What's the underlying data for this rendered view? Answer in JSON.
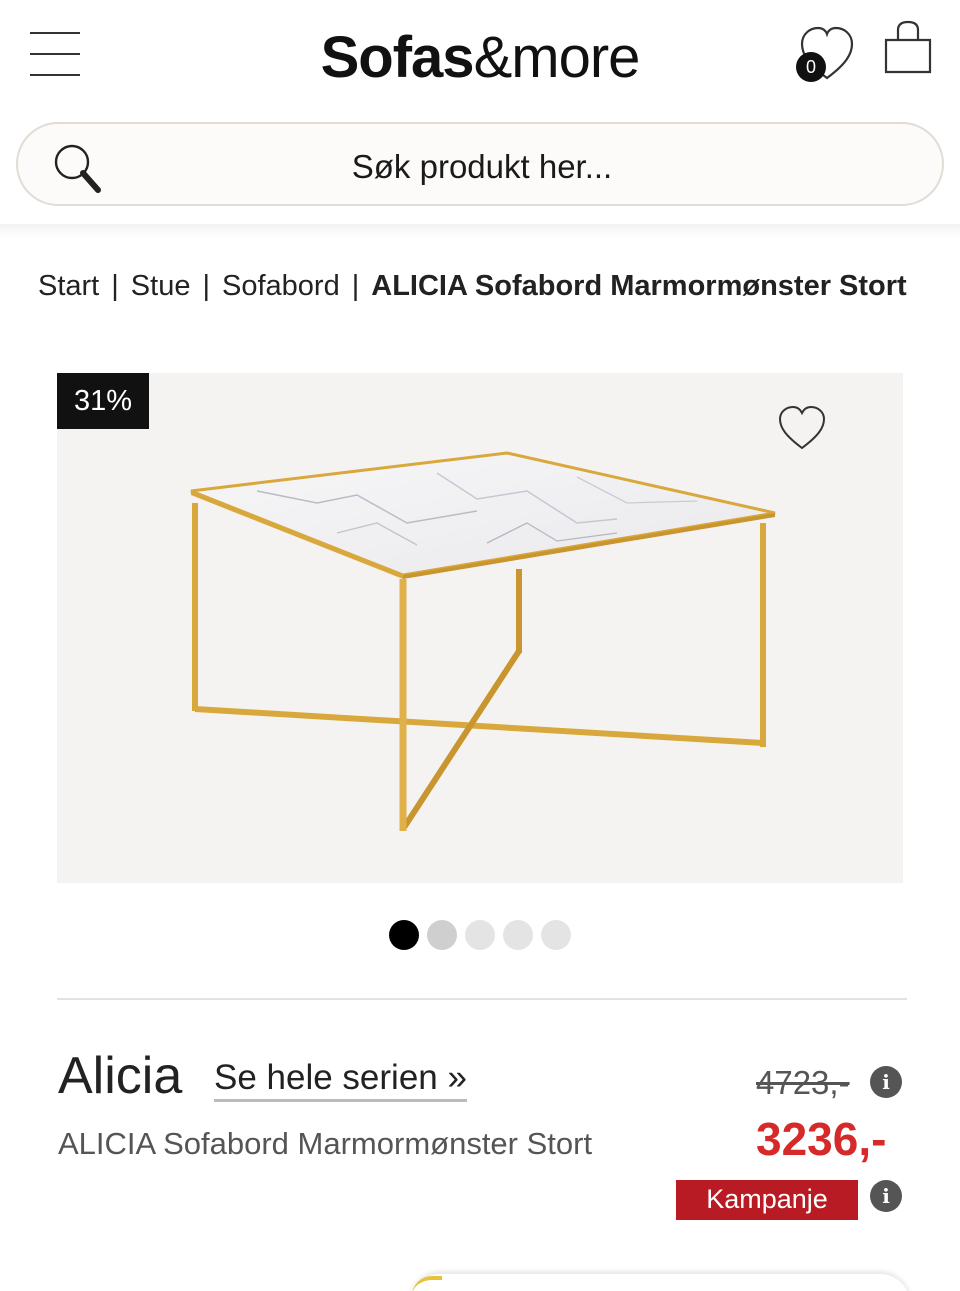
{
  "header": {
    "logo_bold": "Sofas",
    "logo_light": "&more",
    "wishlist_count": "0"
  },
  "search": {
    "placeholder": "Søk produkt her..."
  },
  "breadcrumb": {
    "items": [
      "Start",
      "Stue",
      "Sofabord"
    ],
    "current": "ALICIA Sofabord Marmormønster Stort",
    "separator": "|"
  },
  "product": {
    "discount_badge": "31%",
    "image_count": 5,
    "active_image_index": 0,
    "name": "Alicia",
    "series_link": "Se hele serien »",
    "description": "ALICIA Sofabord Marmormønster Stort",
    "old_price": "4723,-",
    "price": "3236,-",
    "campaign_label": "Kampanje"
  },
  "colors": {
    "price_red": "#d62a2a",
    "campaign_red": "#b81b24",
    "gold": "#d9a83c"
  },
  "icons": {
    "menu": "hamburger-icon",
    "wishlist": "heart-icon",
    "cart": "shopping-bag-icon",
    "search": "magnifier-icon",
    "favorite": "heart-outline-icon",
    "info": "info-icon"
  }
}
